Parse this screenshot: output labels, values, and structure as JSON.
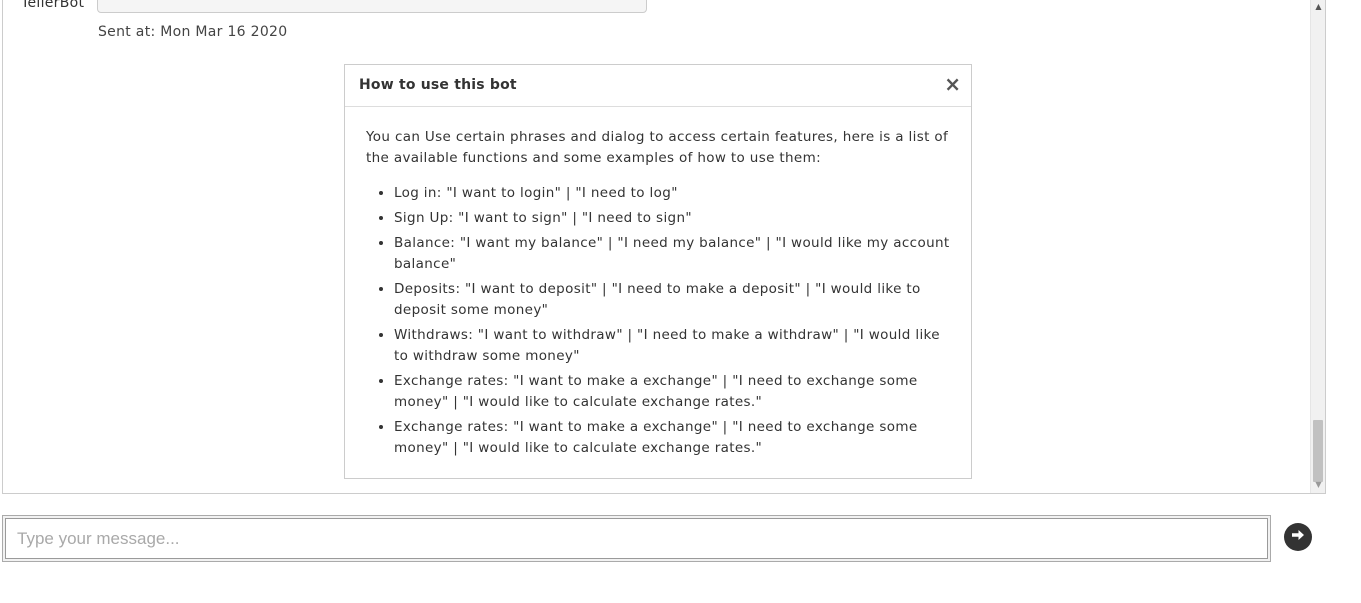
{
  "chat": {
    "sender": "TellerBot",
    "sent_at": "Sent at: Mon Mar 16 2020"
  },
  "help": {
    "title": "How to use this bot",
    "close_symbol": "×",
    "intro": "You can Use certain phrases and dialog to access certain features, here is a list of the available functions and some examples of how to use them:",
    "items": [
      "Log in: \"I want to login\" | \"I need to log\"",
      "Sign Up: \"I want to sign\" | \"I need to sign\"",
      "Balance: \"I want my balance\" | \"I need my balance\" | \"I would like my account balance\"",
      "Deposits: \"I want to deposit\" | \"I need to make a deposit\" | \"I would like to deposit some money\"",
      "Withdraws: \"I want to withdraw\" | \"I need to make a withdraw\" | \"I would like to withdraw some money\"",
      "Exchange rates: \"I want to make a exchange\" | \"I need to exchange some money\" | \"I would like to calculate exchange rates.\"",
      "Exchange rates: \"I want to make a exchange\" | \"I need to exchange some money\" | \"I would like to calculate exchange rates.\""
    ]
  },
  "scrollbar": {
    "up_icon": "arrow-up-icon",
    "down_icon": "arrow-down-icon"
  },
  "composer": {
    "value": "",
    "placeholder": "Type your message...",
    "send_icon": "arrow-right-circle-icon"
  },
  "colors": {
    "send_button": "#333333",
    "border": "#cccccc"
  }
}
